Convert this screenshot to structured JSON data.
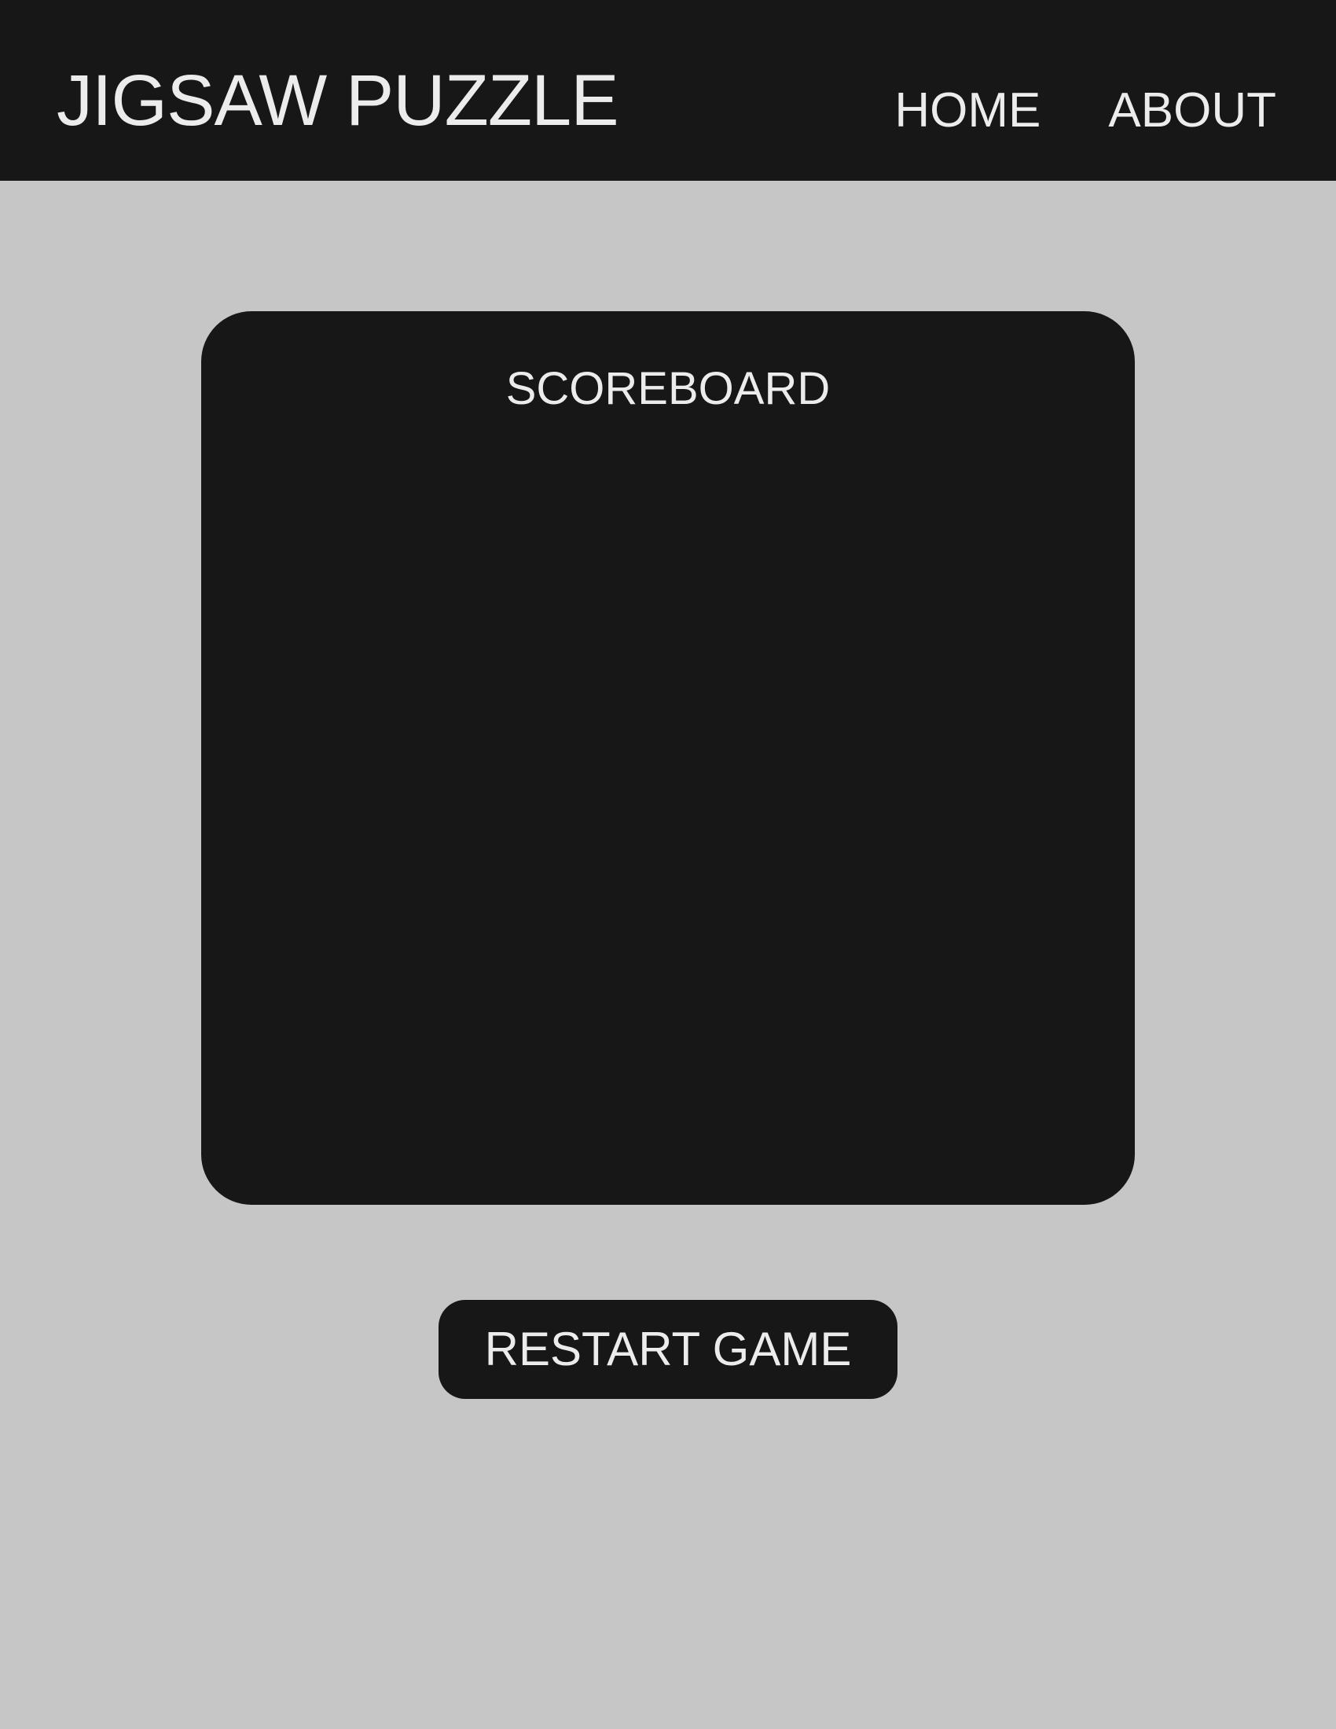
{
  "header": {
    "title": "JIGSAW PUZZLE",
    "nav": [
      {
        "label": "HOME"
      },
      {
        "label": "ABOUT"
      }
    ]
  },
  "scoreboard": {
    "title": "SCOREBOARD"
  },
  "actions": {
    "restart_label": "RESTART GAME"
  },
  "colors": {
    "page_background": "#c6c6c6",
    "panel": "#171717",
    "text": "#ececec"
  }
}
